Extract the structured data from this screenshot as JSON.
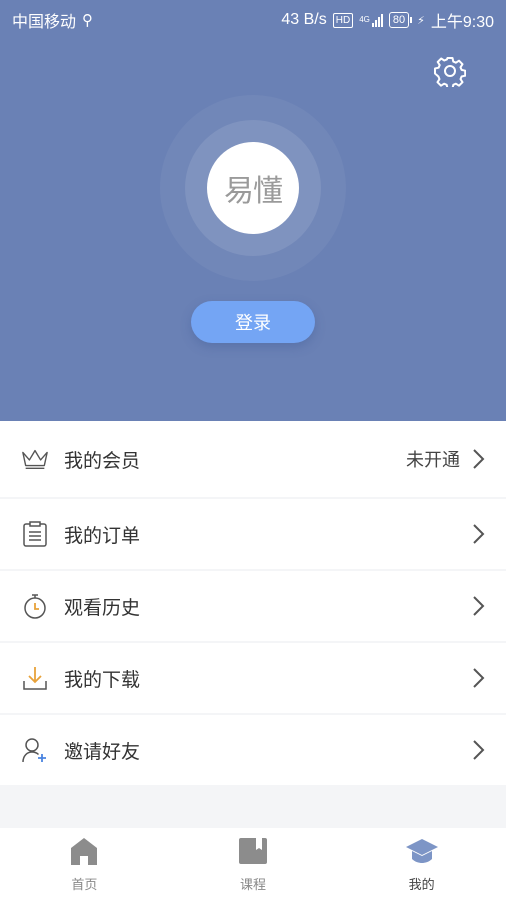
{
  "status_bar": {
    "carrier": "中国移动",
    "speed": "43 B/s",
    "hd": "HD",
    "network": "4G",
    "battery": "80",
    "time": "上午9:30"
  },
  "profile": {
    "avatar_text": "易懂",
    "login_label": "登录"
  },
  "menu": [
    {
      "label": "我的会员",
      "value": "未开通",
      "icon": "crown-icon"
    },
    {
      "label": "我的订单",
      "value": "",
      "icon": "order-list-icon"
    },
    {
      "label": "观看历史",
      "value": "",
      "icon": "stopwatch-icon"
    },
    {
      "label": "我的下载",
      "value": "",
      "icon": "download-icon"
    },
    {
      "label": "邀请好友",
      "value": "",
      "icon": "add-user-icon"
    }
  ],
  "tabs": [
    {
      "label": "首页",
      "icon": "home-icon",
      "active": false
    },
    {
      "label": "课程",
      "icon": "course-book-icon",
      "active": false
    },
    {
      "label": "我的",
      "icon": "graduation-cap-icon",
      "active": true
    }
  ],
  "colors": {
    "header_bg": "#6a81b5",
    "login_button": "#74a5f4",
    "active_tab": "#7d95c6",
    "inactive_tab": "#8c8c8c"
  }
}
